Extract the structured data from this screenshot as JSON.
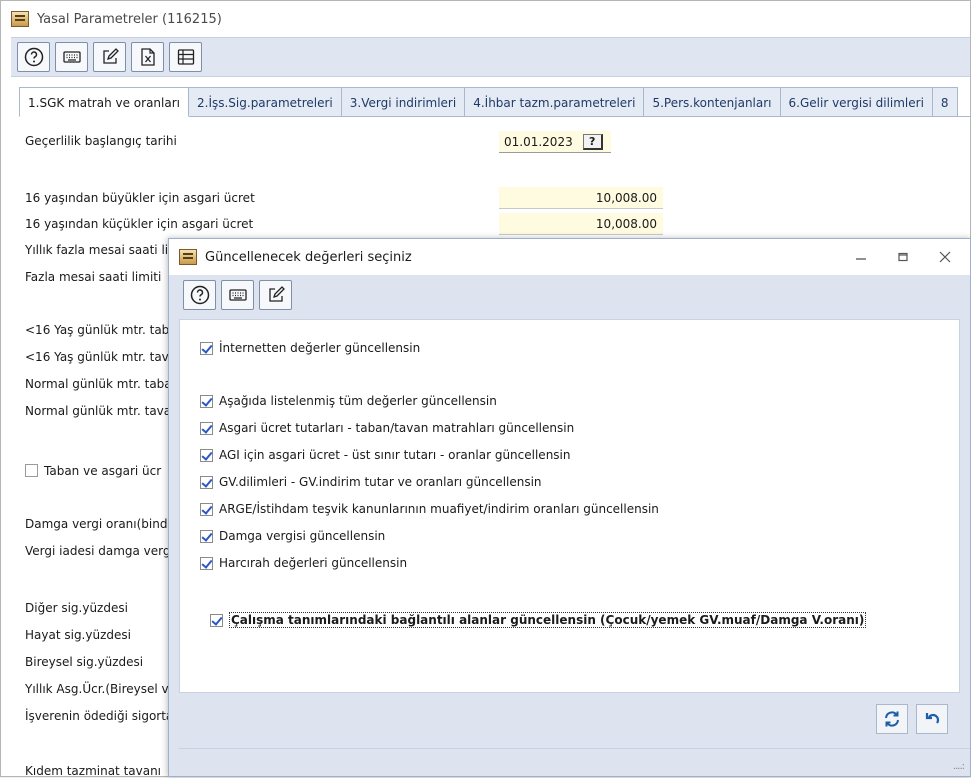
{
  "main": {
    "title": "Yasal Parametreler (116215)",
    "toolbar": [
      {
        "name": "help-button",
        "icon": "help-icon"
      },
      {
        "name": "keyboard-button",
        "icon": "keyboard-icon"
      },
      {
        "name": "edit-button",
        "icon": "edit-icon"
      },
      {
        "name": "excel-button",
        "icon": "excel-icon"
      },
      {
        "name": "grid-button",
        "icon": "grid-icon"
      }
    ],
    "tabs": [
      {
        "label": "1.SGK matrah ve oranları",
        "active": true
      },
      {
        "label": "2.İşs.Sig.parametreleri"
      },
      {
        "label": "3.Vergi indirimleri"
      },
      {
        "label": "4.İhbar tazm.parametreleri"
      },
      {
        "label": "5.Pers.kontenjanları"
      },
      {
        "label": "6.Gelir vergisi dilimleri"
      },
      {
        "label": "8"
      }
    ],
    "fields": {
      "start_date_label": "Geçerlilik başlangıç tarihi",
      "start_date_value": "01.01.2023",
      "start_date_button": "?",
      "min_wage_over16_label": "16 yaşından büyükler için asgari ücret",
      "min_wage_over16_value": "10,008.00",
      "min_wage_under16_label": "16 yaşından küçükler için asgari ücret",
      "min_wage_under16_value": "10,008.00"
    },
    "labels": [
      "Yıllık fazla mesai saati lim",
      "Fazla mesai saati limiti",
      "<16 Yaş günlük mtr. tab",
      "<16 Yaş günlük mtr. tav",
      "Normal günlük mtr. taba",
      "Normal günlük mtr. tava",
      "Taban ve asgari ücr",
      "Damga vergi oranı(binde",
      "Vergi iadesi damga verg",
      "Diğer sig.yüzdesi",
      "Hayat sig.yüzdesi",
      "Bireysel sig.yüzdesi",
      "Yıllık Asg.Ücr.(Bireysel v",
      "İşverenin ödediği sigorta",
      "Kıdem tazminat tavanı"
    ]
  },
  "dialog": {
    "title": "Güncellenecek değerleri seçiniz",
    "options": [
      {
        "label": "İnternetten değerler güncellensin",
        "checked": true
      },
      {
        "label": "Aşağıda listelenmiş tüm değerler güncellensin",
        "checked": true
      },
      {
        "label": "Asgari ücret tutarları - taban/tavan matrahları güncellensin",
        "checked": true
      },
      {
        "label": "AGI için asgari ücret - üst sınır tutarı - oranlar güncellensin",
        "checked": true
      },
      {
        "label": "GV.dilimleri - GV.indirim tutar ve oranları güncellensin",
        "checked": true
      },
      {
        "label": "ARGE/İstihdam teşvik kanunlarının muafiyet/indirim oranları güncellensin",
        "checked": true
      },
      {
        "label": "Damga vergisi güncellensin",
        "checked": true
      },
      {
        "label": "Harcırah değerleri güncellensin",
        "checked": true
      },
      {
        "label": "Çalışma tanımlarındaki bağlantılı alanlar güncellensin (Çocuk/yemek GV.muaf/Damga V.oranı)",
        "checked": true
      }
    ],
    "footer": [
      {
        "name": "apply-button",
        "icon": "refresh-icon"
      },
      {
        "name": "undo-button",
        "icon": "undo-icon"
      }
    ],
    "grip": "....:"
  },
  "colors": {
    "accent": "#2a56c6",
    "toolbar_bg": "#dfe6f2",
    "input_bg": "#fffbe0"
  }
}
